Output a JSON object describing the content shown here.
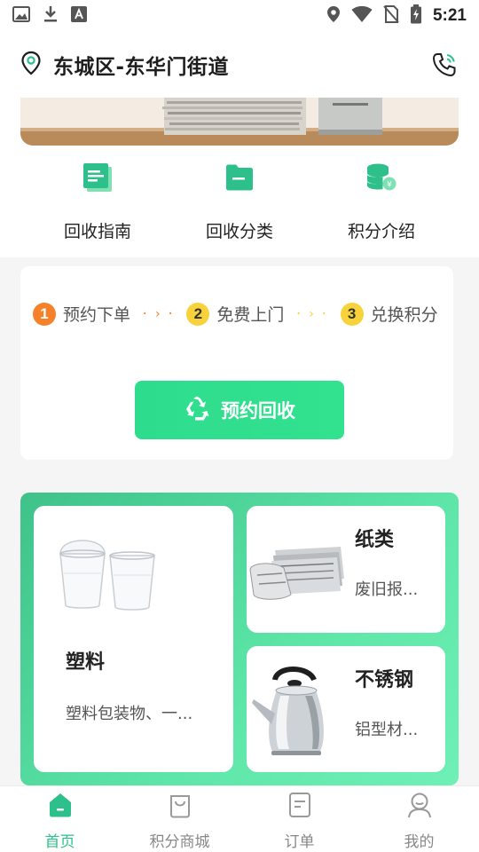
{
  "status_bar": {
    "time": "5:21",
    "left_icons": [
      "image-icon",
      "download-icon",
      "a-box-icon"
    ],
    "right_icons": [
      "location-pin-icon",
      "wifi-icon",
      "no-sim-icon",
      "battery-charging-icon"
    ]
  },
  "header": {
    "location": "东城区-东华门街道",
    "phone_icon": "phone-ringing-icon"
  },
  "quick_menu": [
    {
      "label": "回收指南",
      "icon": "guide-doc-icon"
    },
    {
      "label": "回收分类",
      "icon": "folder-icon"
    },
    {
      "label": "积分介绍",
      "icon": "coin-stack-icon"
    }
  ],
  "steps": [
    {
      "num": "1",
      "label": "预约下单",
      "color": "#f5822a"
    },
    {
      "num": "2",
      "label": "免费上门",
      "color": "#f8d23a"
    },
    {
      "num": "3",
      "label": "兑换积分",
      "color": "#f8d23a"
    }
  ],
  "reserve_button": {
    "label": "预约回收",
    "icon": "recycle-icon"
  },
  "categories": [
    {
      "name": "塑料",
      "desc": "塑料包装物、一...",
      "image": "plastic-cups"
    },
    {
      "name": "纸类",
      "desc": "废旧报...",
      "image": "newspaper-stack"
    },
    {
      "name": "不锈钢",
      "desc": "铝型材...",
      "image": "steel-kettle"
    }
  ],
  "bottom_nav": [
    {
      "label": "首页",
      "icon": "home-icon",
      "active": true
    },
    {
      "label": "积分商城",
      "icon": "shopping-bag-icon",
      "active": false
    },
    {
      "label": "订单",
      "icon": "order-doc-icon",
      "active": false
    },
    {
      "label": "我的",
      "icon": "user-icon",
      "active": false
    }
  ],
  "colors": {
    "brand_green": "#2ec08a",
    "button_green": "#32e28e",
    "step1_orange": "#f5822a",
    "step_yellow": "#f8d23a"
  }
}
